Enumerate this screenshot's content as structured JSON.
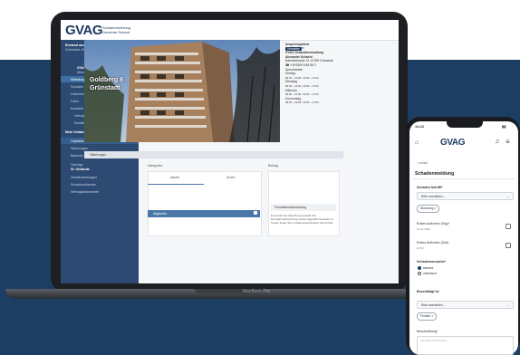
{
  "app": {
    "logo": "GVAG",
    "logo_sub_1": "Schadenmeldung",
    "logo_sub_2": "Gewerbe Schadt"
  },
  "sidebar": {
    "heading": "Bestand aus dem Portfolio",
    "subheading": "Grünstadt, Hauptstr. 1 – Wohnanlage",
    "section_1": "GVAG Gebäudeversicherung",
    "section_1_sub": "Alexander Schacht",
    "items_1": [
      "Mitteilungen",
      "Schaden",
      "Dokumente",
      "Fotos",
      "Kontakte",
      "Verträge",
      "Kontakte"
    ],
    "section_2": "Mein Gebäude",
    "items_2": [
      "Objektübersicht",
      "Wohnungen",
      "Bauliche Ausstattung"
    ],
    "section_3": "Verträge",
    "section_3_sub": "SL Gebäude",
    "items_3": [
      "Gewährleistungen",
      "Schadenshistorie",
      "Vertragsdokumente"
    ]
  },
  "toolbar": {
    "tab_1": "GVAG Gebäudeversicherung Alexander Schacht",
    "tab_2": "SN-Gebäude-B",
    "tab_3": "anzeigen"
  },
  "photo": {
    "caption_1": "Goldberg 8",
    "caption_2": "Grünstadt"
  },
  "contact": {
    "title": "Ansprechpartner",
    "badge": "Verwalter",
    "company": "GVAG Gebäudeverwaltung",
    "person": "Alexander Schacht",
    "address": "Bahnhofstraße 12, 67269 Grünstadt",
    "phone": "+49 6359 8 88 88 0",
    "hours_label": "Sprechzeiten",
    "days": [
      {
        "day": "Montag",
        "time": "08:00 – 12:00 / 13:00 – 17:00"
      },
      {
        "day": "Dienstag",
        "time": "08:00 – 12:00 / 13:00 – 17:00"
      },
      {
        "day": "Mittwoch",
        "time": "08:00 – 12:00 / 13:00 – 17:00"
      },
      {
        "day": "Donnerstag",
        "time": "08:00 – 12:00 / 13:00 – 17:00"
      }
    ]
  },
  "main": {
    "section_title": "Mitteilungen",
    "left_label": "Kategorien",
    "right_label": "Beitrag",
    "col_1": "aktuell",
    "col_2": "Archiv",
    "row_label": "Allgemein",
    "notice_title": "Fernwärmeabrechnung",
    "notice_text": "Es wurde eine Abrechnung erstellt. Die Fernwärmeabrechnung wurde zugestellt. Hinweise zu Kosten finden Sie im Dokumentenbereich des Portals."
  },
  "device": {
    "brand": "MacBook Pro"
  },
  "phone": {
    "time": "14:22",
    "logo": "GVAG",
    "back": "zurück",
    "title": "Schadenmeldung",
    "field_1_label": "Schaden betrifft*",
    "field_1_value": "Bitte auswählen...",
    "pill_1": "Wohnung",
    "field_2_label": "Erstes Auftreten (Tag)*",
    "field_2_value": "12.01.2022",
    "field_3_label": "Erstes Auftreten (Zeit)",
    "field_3_value": "10:00",
    "field_4_label": "Schadensursache*",
    "radio_1": "bekannt",
    "radio_2": "unbekannt",
    "field_5_label": "Beschädigt ist",
    "field_5_value": "Bitte auswählen...",
    "pill_2": "Fenster",
    "field_6_label": "Beschreibung*",
    "field_6_placeholder": "Schaden beschreiben..."
  },
  "colors": {
    "navy": "#1c3e63",
    "sidebar": "#2c4a72",
    "accent": "#4a77a8",
    "brand": "#1e3a5f"
  }
}
